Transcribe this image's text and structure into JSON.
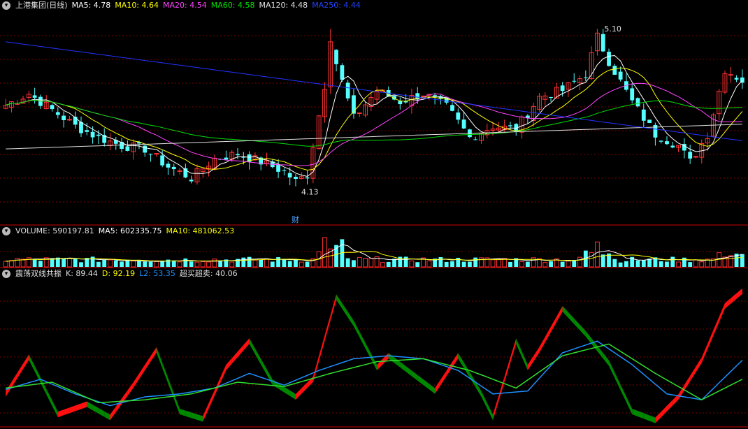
{
  "colors": {
    "up": "#ff3232",
    "down": "#54ffff",
    "ma5": "#ffffff",
    "ma10": "#ffff00",
    "ma20": "#ff44ff",
    "ma60": "#00e000",
    "ma120": "#e0e0e0",
    "ma250": "#2233ff",
    "kbar_up": "#ff1010",
    "kbar_down": "#008800",
    "d_line": "#1e90ff",
    "l2_line": "#30e030",
    "grid": "#7a0000",
    "panel_line": "#cc0000"
  },
  "panels": {
    "price": {
      "icon": "chevron-down-icon",
      "title": "上港集团(日线)",
      "ma5": "MA5: 4.78",
      "ma10": "MA10: 4.64",
      "ma20": "MA20: 4.54",
      "ma60": "MA60: 4.58",
      "ma120": "MA120: 4.48",
      "ma250": "MA250: 4.44"
    },
    "volume": {
      "icon": "chevron-down-icon",
      "vol": "VOLUME: 590197.81",
      "ma5": "MA5: 602335.75",
      "ma10": "MA10: 481062.53"
    },
    "oscillator": {
      "icon": "chevron-down-icon",
      "title": "震荡双线共振",
      "k": "K: 89.44",
      "d": "D: 92.19",
      "l2": "L2: 53.35",
      "ob": "超买超卖: 40.06"
    }
  },
  "chart_data": [
    {
      "type": "candlestick",
      "ylim": [
        3.9,
        5.2
      ],
      "series_name": "上港集团(日线)",
      "count": 128,
      "ohlc_anchors": [
        [
          0,
          4.63
        ],
        [
          4,
          4.7
        ],
        [
          8,
          4.6
        ],
        [
          12,
          4.5
        ],
        [
          16,
          4.43
        ],
        [
          20,
          4.38
        ],
        [
          24,
          4.36
        ],
        [
          28,
          4.25
        ],
        [
          32,
          4.18
        ],
        [
          36,
          4.3
        ],
        [
          40,
          4.33
        ],
        [
          44,
          4.28
        ],
        [
          48,
          4.22
        ],
        [
          50,
          4.16
        ],
        [
          52,
          4.2
        ],
        [
          55,
          4.75
        ],
        [
          56,
          5.0
        ],
        [
          60,
          4.55
        ],
        [
          64,
          4.72
        ],
        [
          68,
          4.65
        ],
        [
          72,
          4.7
        ],
        [
          76,
          4.62
        ],
        [
          80,
          4.43
        ],
        [
          84,
          4.5
        ],
        [
          88,
          4.48
        ],
        [
          92,
          4.68
        ],
        [
          96,
          4.72
        ],
        [
          100,
          4.82
        ],
        [
          102,
          5.05
        ],
        [
          104,
          4.9
        ],
        [
          108,
          4.65
        ],
        [
          112,
          4.45
        ],
        [
          116,
          4.38
        ],
        [
          118,
          4.28
        ],
        [
          121,
          4.45
        ],
        [
          124,
          4.85
        ],
        [
          127,
          4.78
        ]
      ],
      "annotations": [
        "5.10",
        "4.13",
        "财"
      ]
    },
    {
      "type": "bar",
      "title": "VOLUME",
      "values_note": "spikes near index 55 and 102"
    },
    {
      "type": "line",
      "series": [
        {
          "name": "K",
          "anchors": [
            [
              0,
              22
            ],
            [
              4,
              47
            ],
            [
              9,
              8
            ],
            [
              14,
              15
            ],
            [
              18,
              6
            ],
            [
              22,
              28
            ],
            [
              26,
              52
            ],
            [
              30,
              10
            ],
            [
              34,
              5
            ],
            [
              38,
              40
            ],
            [
              42,
              58
            ],
            [
              46,
              30
            ],
            [
              50,
              20
            ],
            [
              53,
              32
            ],
            [
              57,
              88
            ],
            [
              60,
              70
            ],
            [
              64,
              40
            ],
            [
              66,
              48
            ],
            [
              70,
              36
            ],
            [
              74,
              24
            ],
            [
              78,
              48
            ],
            [
              82,
              22
            ],
            [
              84,
              6
            ],
            [
              88,
              58
            ],
            [
              90,
              40
            ],
            [
              92,
              52
            ],
            [
              96,
              80
            ],
            [
              100,
              63
            ],
            [
              104,
              43
            ],
            [
              108,
              10
            ],
            [
              112,
              4
            ],
            [
              116,
              20
            ],
            [
              120,
              45
            ],
            [
              124,
              82
            ],
            [
              127,
              92
            ]
          ]
        },
        {
          "name": "D",
          "anchors": [
            [
              0,
              25
            ],
            [
              6,
              32
            ],
            [
              12,
              22
            ],
            [
              18,
              14
            ],
            [
              24,
              20
            ],
            [
              30,
              22
            ],
            [
              36,
              26
            ],
            [
              42,
              36
            ],
            [
              48,
              28
            ],
            [
              54,
              38
            ],
            [
              60,
              46
            ],
            [
              66,
              48
            ],
            [
              72,
              46
            ],
            [
              78,
              38
            ],
            [
              84,
              22
            ],
            [
              90,
              24
            ],
            [
              96,
              50
            ],
            [
              102,
              58
            ],
            [
              108,
              42
            ],
            [
              114,
              22
            ],
            [
              120,
              18
            ],
            [
              127,
              45
            ]
          ]
        },
        {
          "name": "L2",
          "anchors": [
            [
              0,
              26
            ],
            [
              8,
              30
            ],
            [
              16,
              16
            ],
            [
              24,
              18
            ],
            [
              32,
              22
            ],
            [
              40,
              30
            ],
            [
              48,
              27
            ],
            [
              56,
              36
            ],
            [
              64,
              44
            ],
            [
              72,
              46
            ],
            [
              80,
              38
            ],
            [
              88,
              26
            ],
            [
              96,
              48
            ],
            [
              104,
              56
            ],
            [
              112,
              36
            ],
            [
              120,
              18
            ],
            [
              127,
              32
            ]
          ]
        }
      ],
      "ylim": [
        0,
        100
      ]
    }
  ]
}
